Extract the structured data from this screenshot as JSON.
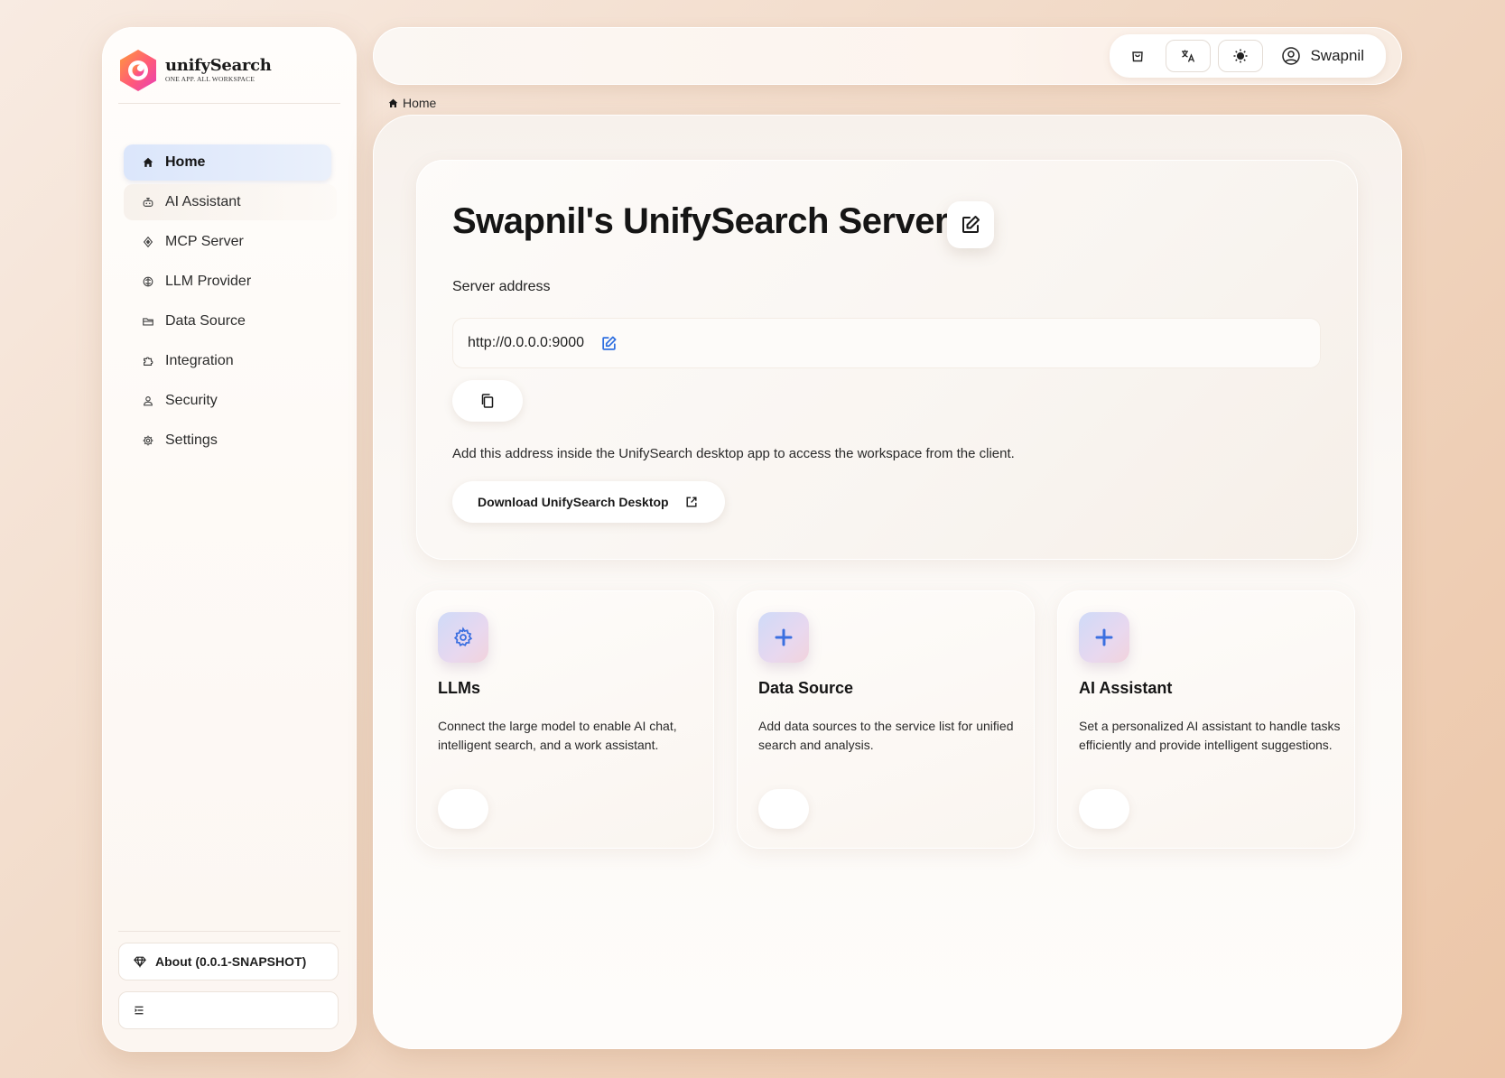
{
  "brand": {
    "name": "unifySearch",
    "tagline": "ONE APP. ALL WORKSPACE"
  },
  "sidebar": {
    "items": [
      {
        "label": "Home",
        "icon": "home-icon",
        "active": true
      },
      {
        "label": "AI Assistant",
        "icon": "robot-icon"
      },
      {
        "label": "MCP Server",
        "icon": "mcp-icon"
      },
      {
        "label": "LLM Provider",
        "icon": "llm-icon"
      },
      {
        "label": "Data Source",
        "icon": "folder-icon"
      },
      {
        "label": "Integration",
        "icon": "puzzle-icon"
      },
      {
        "label": "Security",
        "icon": "user-lock-icon"
      },
      {
        "label": "Settings",
        "icon": "gear-icon"
      }
    ],
    "about_label": "About (0.0.1-SNAPSHOT)",
    "collapse_icon": "menu-collapse-icon"
  },
  "topbar": {
    "user_name": "Swapnil",
    "icons": [
      "store-icon",
      "translate-icon",
      "sun-icon",
      "user-circle-icon"
    ]
  },
  "breadcrumb": {
    "home": "Home"
  },
  "server": {
    "title": "Swapnil's UnifySearch Server",
    "address_label": "Server address",
    "address": "http://0.0.0.0:9000",
    "hint": "Add this address inside the UnifySearch desktop app to access the workspace from the client.",
    "download_label": "Download UnifySearch Desktop"
  },
  "features": [
    {
      "title": "LLMs",
      "desc": "Connect the large model to enable AI chat, intelligent search, and a work assistant.",
      "icon": "gear-icon"
    },
    {
      "title": "Data Source",
      "desc": "Add data sources to the service list for unified search and analysis.",
      "icon": "plus-icon"
    },
    {
      "title": "AI Assistant",
      "desc": "Set a personalized AI assistant to handle tasks efficiently and provide intelligent suggestions.",
      "icon": "plus-icon"
    }
  ],
  "colors": {
    "accent": "#3b6fe0",
    "active_nav": "#dbe6fb",
    "background": "#f1d9c6"
  }
}
